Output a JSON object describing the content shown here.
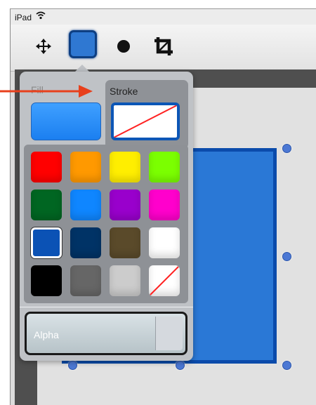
{
  "status_bar": {
    "device": "iPad",
    "wifi_icon": "wifi-icon"
  },
  "toolbar": {
    "tools": [
      {
        "id": "move",
        "icon": "move-icon"
      },
      {
        "id": "rectangle",
        "icon": "rectangle-icon",
        "active": true,
        "color": "#2f78d2"
      },
      {
        "id": "circle",
        "icon": "circle-icon"
      },
      {
        "id": "crop",
        "icon": "crop-icon"
      }
    ]
  },
  "color_popover": {
    "fill_tab": {
      "label": "Fill",
      "color": "#2a8cf5"
    },
    "stroke_tab": {
      "label": "Stroke",
      "active": true,
      "color": "#0c56b6"
    },
    "palette": [
      [
        "#ff0000",
        "#ff9900",
        "#ffee00",
        "#7bff00"
      ],
      [
        "#006622",
        "#0f86ff",
        "#9900cc",
        "#ff00cc"
      ],
      [
        "#0b52b5",
        "#003366",
        "#5a4a2a",
        "#ffffff"
      ],
      [
        "#000000",
        "#666666",
        "#cccccc",
        "none"
      ]
    ],
    "selected_swatch": "#0b52b5",
    "alpha": {
      "label": "Alpha"
    }
  },
  "canvas": {
    "shape": {
      "type": "rectangle",
      "fill": "#2a78d6",
      "stroke": "#0b4bab"
    }
  },
  "annotation": {
    "arrow_color": "#e8401c"
  }
}
